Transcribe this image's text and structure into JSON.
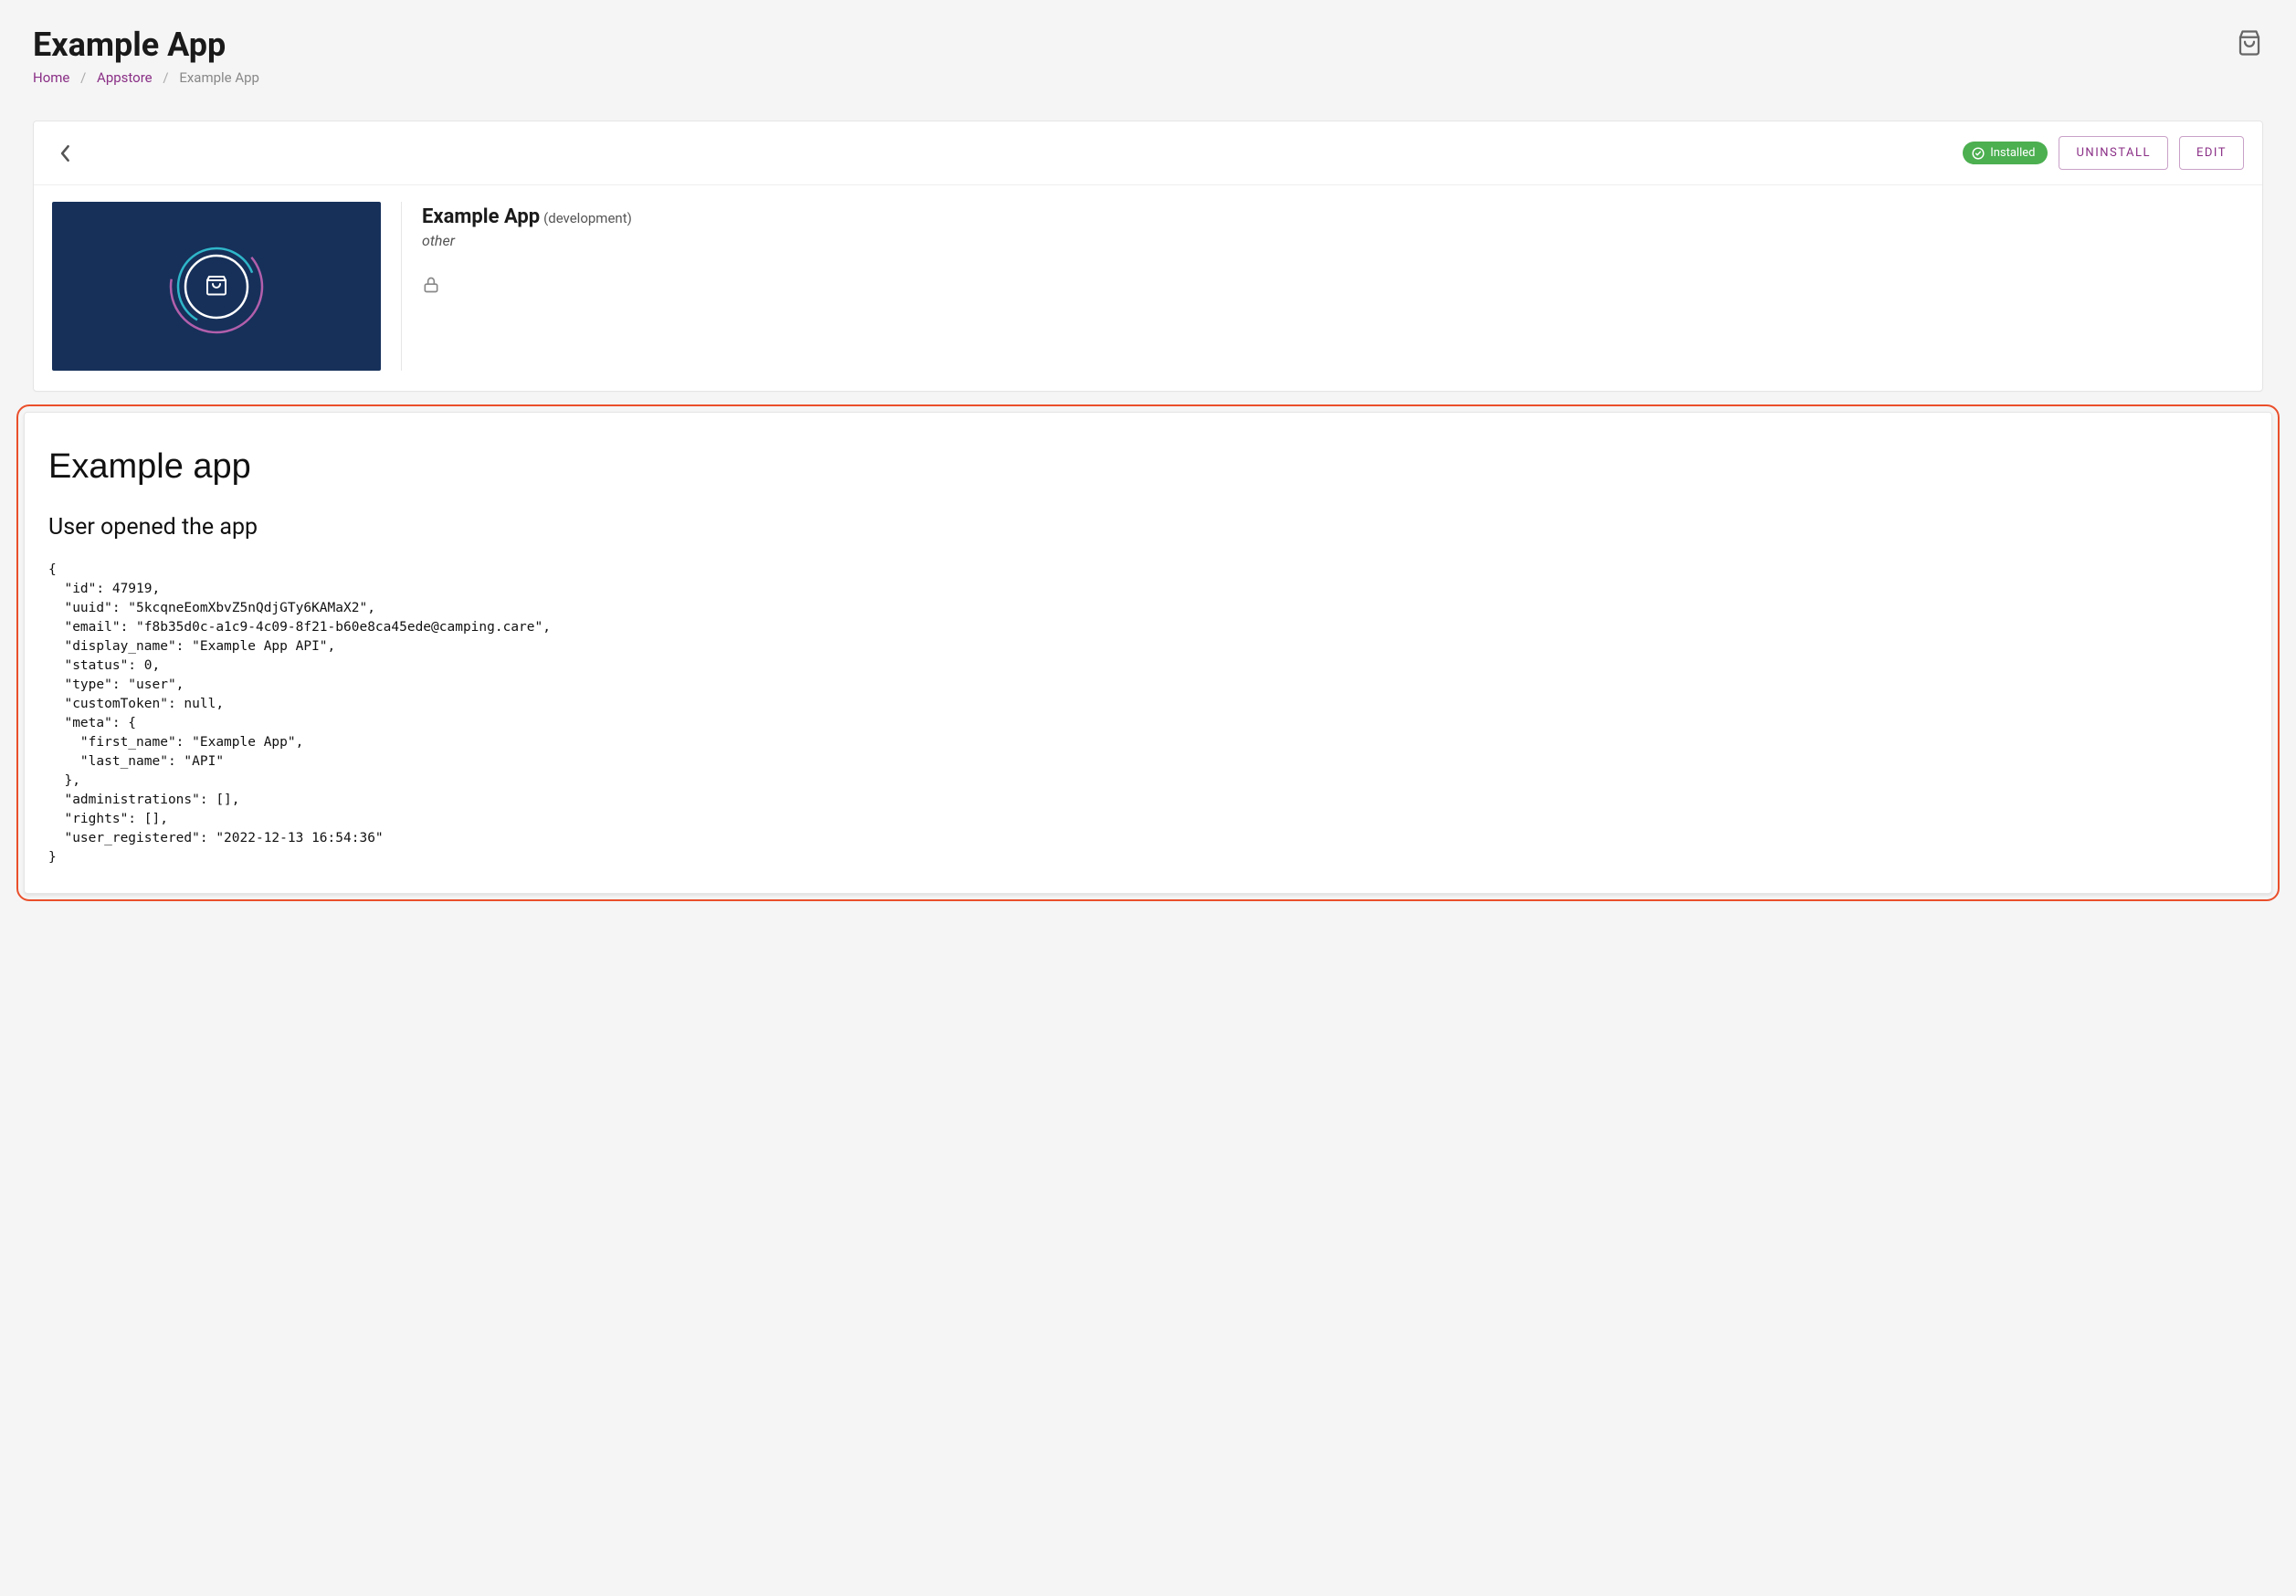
{
  "header": {
    "title": "Example App"
  },
  "breadcrumb": {
    "home": "Home",
    "appstore": "Appstore",
    "current": "Example App"
  },
  "toolbar": {
    "installed_label": "Installed",
    "uninstall_label": "Uninstall",
    "edit_label": "Edit"
  },
  "app": {
    "name": "Example App",
    "stage": "(development)",
    "category": "other"
  },
  "panel": {
    "heading": "Example app",
    "subheading": "User opened the app",
    "json_dump": "{\n  \"id\": 47919,\n  \"uuid\": \"5kcqneEomXbvZ5nQdjGTy6KAMaX2\",\n  \"email\": \"f8b35d0c-a1c9-4c09-8f21-b60e8ca45ede@camping.care\",\n  \"display_name\": \"Example App API\",\n  \"status\": 0,\n  \"type\": \"user\",\n  \"customToken\": null,\n  \"meta\": {\n    \"first_name\": \"Example App\",\n    \"last_name\": \"API\"\n  },\n  \"administrations\": [],\n  \"rights\": [],\n  \"user_registered\": \"2022-12-13 16:54:36\"\n}"
  },
  "colors": {
    "accent_purple": "#8a2f86",
    "installed_green": "#4caf50",
    "highlight_orange": "#ea4f2b",
    "tile_navy": "#16305a"
  }
}
